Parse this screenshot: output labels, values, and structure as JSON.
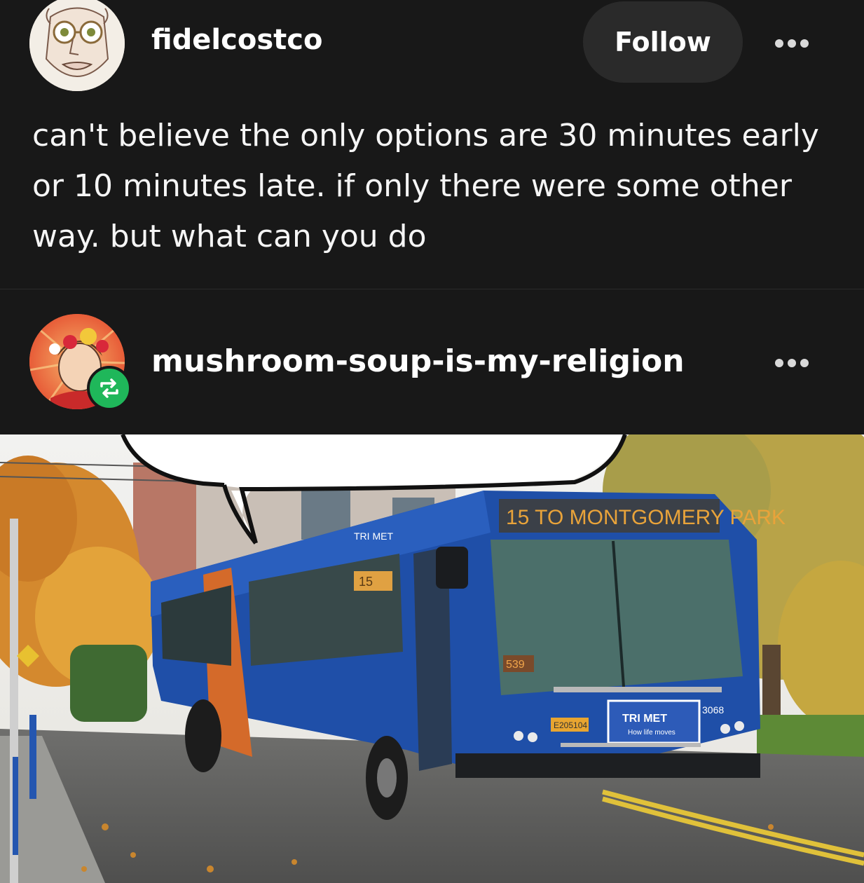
{
  "post": {
    "author": "fidelcostco",
    "follow_label": "Follow",
    "text": "can't believe the only options are 30 minutes early or 10 minutes late. if only there were some other way. but what can you do"
  },
  "reblog": {
    "author": "mushroom-soup-is-my-religion"
  },
  "image": {
    "route_sign": "15 TO MONTGOMERY PARK",
    "brand": "TRI MET",
    "tagline": "How life moves",
    "bus_number": "3068",
    "side_sign": "15",
    "windshield_number": "539",
    "plate": "E205104"
  },
  "colors": {
    "background": "#181818",
    "button": "#2a2a2a",
    "reblog_badge": "#1fb75a",
    "bus_blue": "#1f4fa8",
    "bus_orange": "#d46a2a"
  }
}
